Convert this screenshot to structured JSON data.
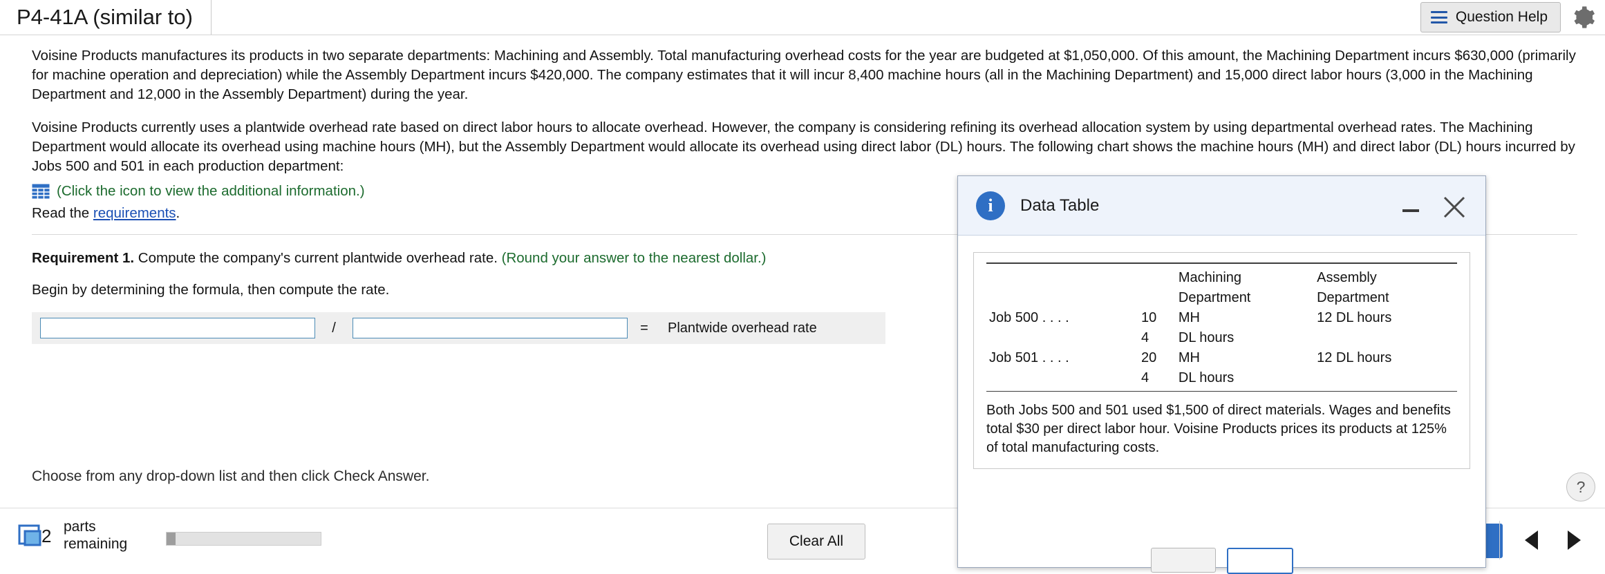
{
  "header": {
    "tab_title": "P4-41A (similar to)",
    "question_help_label": "Question Help",
    "menu_icon": "hamburger-icon",
    "gear_icon": "gear-icon"
  },
  "problem": {
    "paragraph1": "Voisine Products manufactures its products in two separate departments: Machining and Assembly. Total manufacturing overhead costs for the year are budgeted at $1,050,000. Of this amount, the Machining Department incurs $630,000 (primarily for machine operation and depreciation) while the Assembly Department incurs $420,000. The company estimates that it will incur 8,400 machine hours (all in the Machining Department) and 15,000 direct labor hours (3,000 in the Machining Department and 12,000 in the Assembly Department) during the year.",
    "paragraph2": "Voisine Products currently uses a plantwide overhead rate based on direct labor hours to allocate overhead. However, the company is considering refining its overhead allocation system by using departmental overhead rates. The Machining Department would allocate its overhead using machine hours (MH), but the Assembly Department would allocate its overhead using direct labor (DL) hours. The following chart shows the machine hours (MH) and direct labor (DL) hours incurred by Jobs 500 and 501 in each production department:",
    "icon_link_text": "(Click the icon to view the additional information.)",
    "read_prefix": "Read the ",
    "read_link": "requirements",
    "read_suffix": "."
  },
  "requirement": {
    "label": "Requirement 1.",
    "text": " Compute the company's current plantwide overhead rate. ",
    "hint": "(Round your answer to the nearest dollar.)",
    "begin_text": "Begin by determining the formula, then compute the rate."
  },
  "formula": {
    "numerator_value": "",
    "denominator_value": "",
    "divider": "/",
    "equals": "=",
    "result_label": "Plantwide overhead rate"
  },
  "instruction": "Choose from any drop-down list and then click Check Answer.",
  "footer": {
    "parts_count": "2",
    "parts_line1": "parts",
    "parts_line2": "remaining",
    "clear_all_label": "Clear All",
    "prev_icon": "triangle-left-icon",
    "next_icon": "triangle-right-icon",
    "help_icon": "question-mark-icon",
    "progress_percent": 6
  },
  "dialog": {
    "title": "Data Table",
    "info_icon": "info-icon",
    "minimize_icon": "minimize-icon",
    "close_icon": "close-icon",
    "table": {
      "columns": [
        "",
        "",
        "Machining\nDepartment",
        "Assembly\nDepartment"
      ],
      "col1_line1": "Machining",
      "col1_line2": "Department",
      "col2_line1": "Assembly",
      "col2_line2": "Department",
      "rows": [
        {
          "label": "Job 500 . . . .",
          "qty": "10",
          "unit": "MH",
          "assembly": "12 DL hours"
        },
        {
          "label": "",
          "qty": "4",
          "unit": "DL hours",
          "assembly": ""
        },
        {
          "label": "Job 501 . . . .",
          "qty": "20",
          "unit": "MH",
          "assembly": "12 DL hours"
        },
        {
          "label": "",
          "qty": "4",
          "unit": "DL hours",
          "assembly": ""
        }
      ]
    },
    "note": "Both Jobs 500 and 501 used $1,500 of direct materials. Wages and benefits total $30 per direct labor hour. Voisine Products prices its products at 125% of total manufacturing costs."
  },
  "colors": {
    "accent_blue": "#2f6fc4",
    "link_blue": "#1a4fb4",
    "green": "#1c6b2e",
    "dialog_header": "#eef3fb"
  }
}
